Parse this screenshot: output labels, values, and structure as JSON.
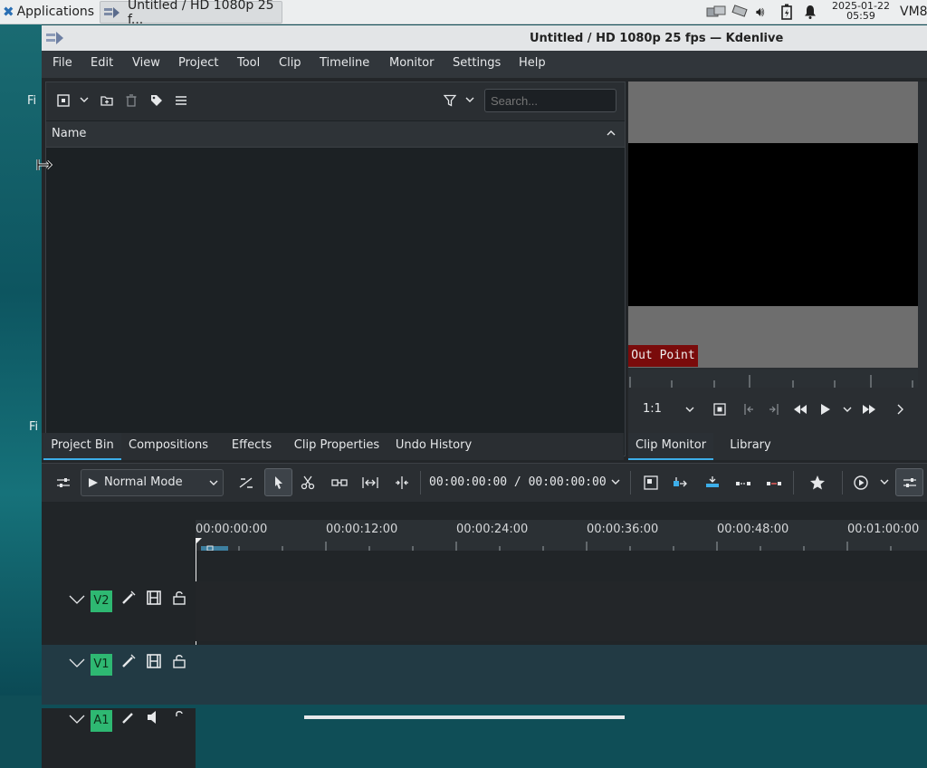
{
  "top_panel": {
    "applications_label": "Applications",
    "task_label": "Untitled / HD 1080p 25 f...",
    "date": "2025-01-22",
    "time": "05:59",
    "host": "VM8"
  },
  "desktop": {
    "label_1": "Fi",
    "label_2": "Fi"
  },
  "window": {
    "title": "Untitled / HD 1080p 25 fps — Kdenlive"
  },
  "menu": {
    "items": [
      "File",
      "Edit",
      "View",
      "Project",
      "Tool",
      "Clip",
      "Timeline",
      "Monitor",
      "Settings",
      "Help"
    ]
  },
  "bin": {
    "search_placeholder": "Search...",
    "column_name": "Name",
    "tabs": [
      "Project Bin",
      "Compositions",
      "Effects",
      "Clip Properties",
      "Undo History"
    ]
  },
  "monitor": {
    "out_point_label": "Out Point",
    "zoom": "1:1",
    "tabs": [
      "Clip Monitor",
      "Library"
    ]
  },
  "timeline": {
    "mode": "Normal Mode",
    "timecode": "00:00:00:00 / 00:00:00:00",
    "ruler_labels": [
      "00:00:00:00",
      "00:00:12:00",
      "00:00:24:00",
      "00:00:36:00",
      "00:00:48:00",
      "00:01:00:00"
    ],
    "tracks": [
      "V2",
      "V1",
      "A1"
    ]
  },
  "colors": {
    "accent": "#3daee9",
    "track_badge": "#2eb872",
    "out_point": "#7a0b0b"
  }
}
